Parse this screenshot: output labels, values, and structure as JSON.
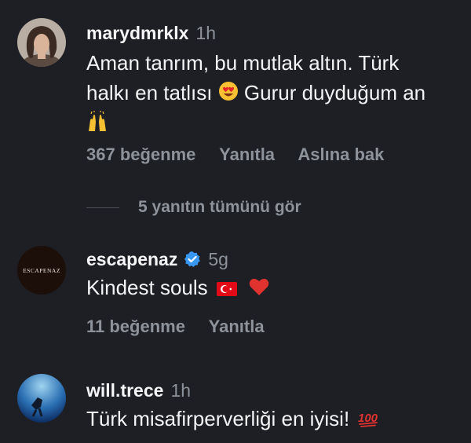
{
  "comments": [
    {
      "username": "marydmrklx",
      "time": "1h",
      "text_line1": "Aman tanrım, bu mutlak altın. Türk",
      "text_line2": "halkı en tatlısı",
      "text_line2_after": "Gurur duyduğum an",
      "likes": "367 beğenme",
      "reply": "Yanıtla",
      "translate": "Aslına bak",
      "view_replies": "5 yanıtın tümünü gör"
    },
    {
      "username": "escapenaz",
      "time": "5g",
      "avatar_text": "ESCAPENAZ",
      "text": "Kindest souls",
      "likes": "11 beğenme",
      "reply": "Yanıtla"
    },
    {
      "username": "will.trece",
      "time": "1h",
      "text": "Türk misafirperverliği en iyisi!"
    }
  ],
  "colors": {
    "background": "#1e1f24",
    "muted": "#8e929b",
    "verified": "#3897f0",
    "heart": "#e0322f"
  },
  "icons": [
    "heart-eyes-emoji",
    "raised-hands-emoji",
    "verified-badge-icon",
    "turkey-flag-emoji",
    "red-heart-emoji",
    "hundred-points-emoji"
  ]
}
